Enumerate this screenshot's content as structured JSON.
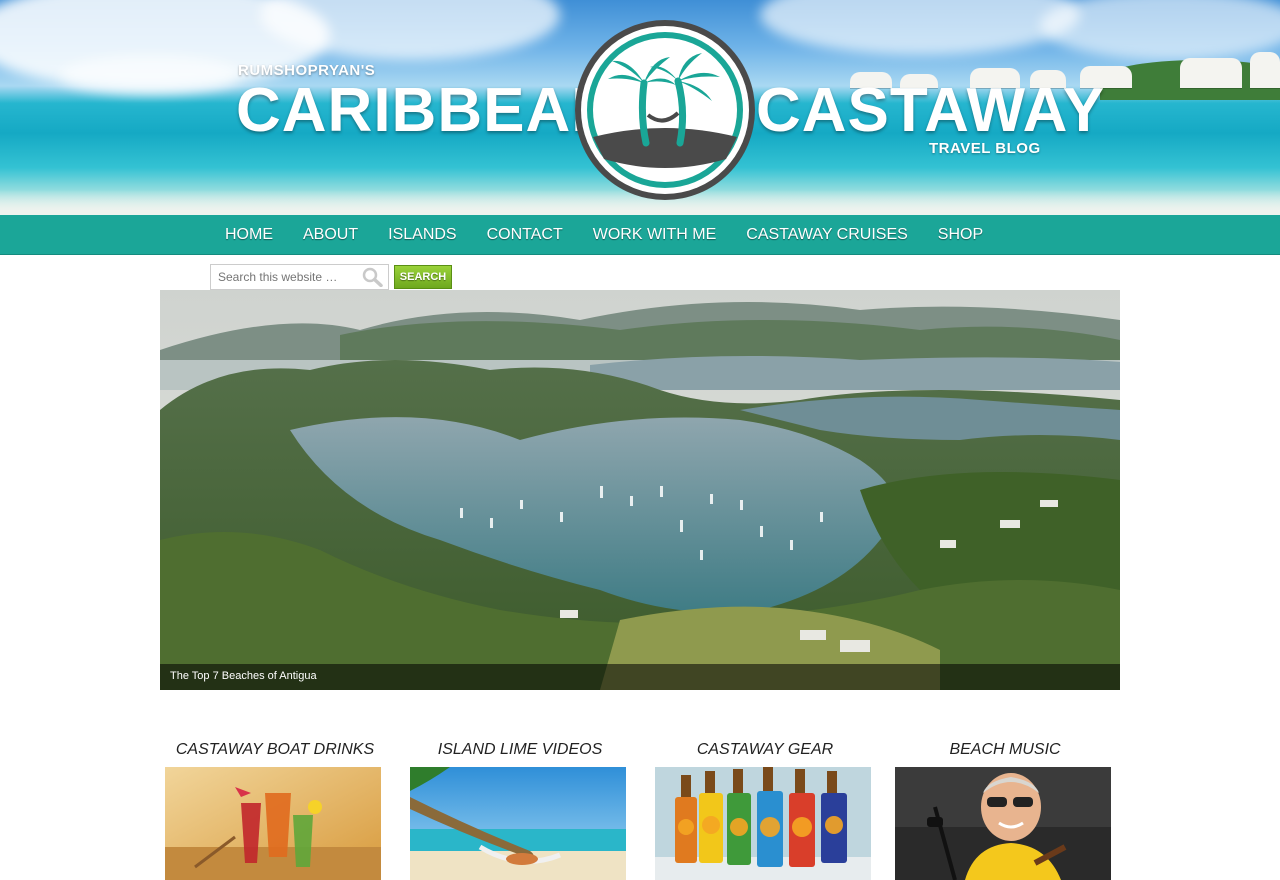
{
  "header": {
    "logo_small": "RUMSHOPRYAN'S",
    "logo_left": "CARIBBEAN",
    "logo_right": "CASTAWAY",
    "logo_travel": "TRAVEL BLOG"
  },
  "nav": {
    "items": [
      {
        "label": "HOME"
      },
      {
        "label": "ABOUT"
      },
      {
        "label": "ISLANDS"
      },
      {
        "label": "CONTACT"
      },
      {
        "label": "WORK WITH ME"
      },
      {
        "label": "CASTAWAY CRUISES"
      },
      {
        "label": "SHOP"
      }
    ]
  },
  "search": {
    "placeholder": "Search this website …",
    "button_label": "SEARCH"
  },
  "hero": {
    "caption": "The Top 7 Beaches of Antigua"
  },
  "features": [
    {
      "title": "CASTAWAY BOAT DRINKS"
    },
    {
      "title": "ISLAND LIME VIDEOS"
    },
    {
      "title": "CASTAWAY GEAR"
    },
    {
      "title": "BEACH MUSIC"
    }
  ],
  "colors": {
    "nav_bg": "#1ba698",
    "search_button": "#7fbf26",
    "logo_teal": "#1aa697"
  }
}
